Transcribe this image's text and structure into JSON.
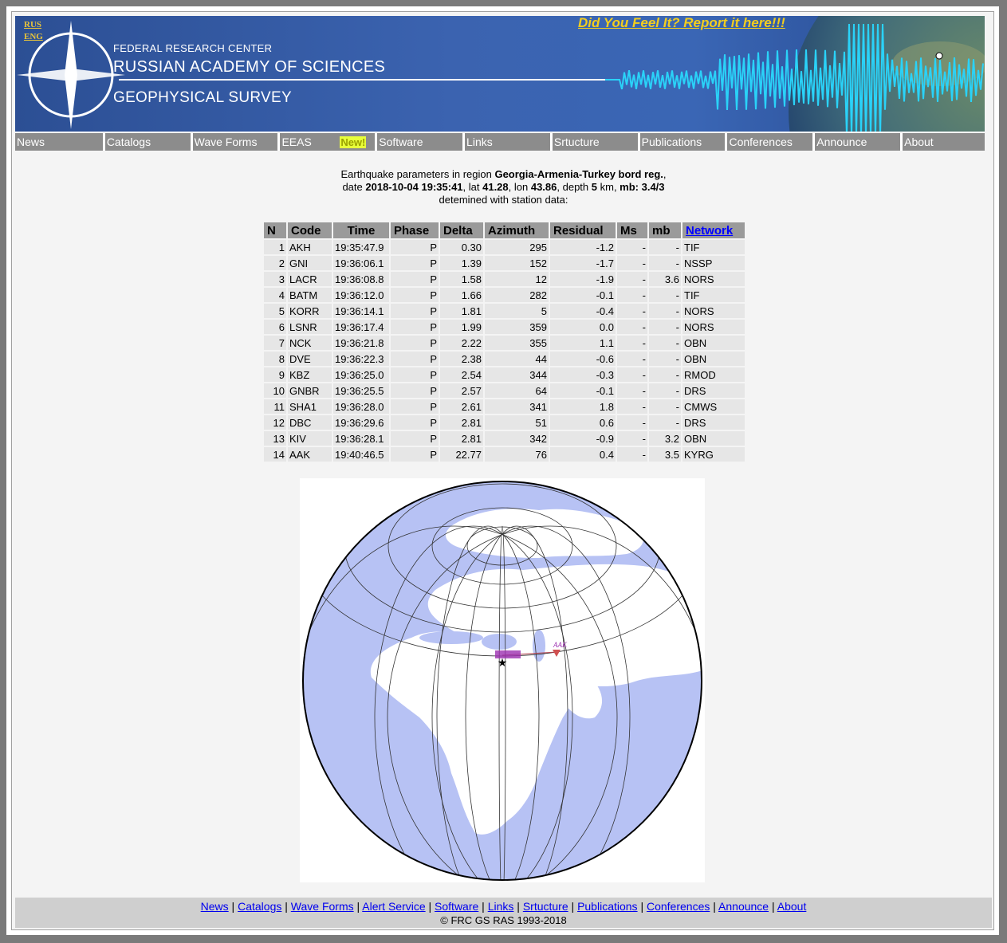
{
  "banner": {
    "lang_rus": "RUS",
    "lang_eng": "ENG",
    "feel_link": "Did You Feel It? Report it here!!!",
    "org_line1": "FEDERAL RESEARCH CENTER",
    "org_line2": "RUSSIAN ACADEMY OF SCIENCES",
    "org_line3": "GEOPHYSICAL SURVEY"
  },
  "nav": [
    "News",
    "Catalogs",
    "Wave Forms",
    "EEAS",
    "New!",
    "Software",
    "Links",
    "Srtucture",
    "Publications",
    "Conferences",
    "Announce",
    "About"
  ],
  "summary": {
    "line1_pre": "Earthquake parameters in region ",
    "region": "Georgia-Armenia-Turkey bord reg.",
    "line1_post": ",",
    "date_label": "date ",
    "date": "2018-10-04 19:35:41",
    "lat_label": ", lat ",
    "lat": "41.28",
    "lon_label": ", lon ",
    "lon": "43.86",
    "depth_label": ", depth ",
    "depth": "5",
    "depth_unit": " km, ",
    "mb_label": "mb: 3.4/3",
    "line3": "detemined with station data:"
  },
  "table": {
    "headers": [
      "N",
      "Code",
      "Time",
      "Phase",
      "Delta",
      "Azimuth",
      "Residual",
      "Ms",
      "mb",
      "Network"
    ],
    "rows": [
      [
        "1",
        "AKH",
        "19:35:47.9",
        "P",
        "0.30",
        "295",
        "-1.2",
        "-",
        "-",
        "TIF"
      ],
      [
        "2",
        "GNI",
        "19:36:06.1",
        "P",
        "1.39",
        "152",
        "-1.7",
        "-",
        "-",
        "NSSP"
      ],
      [
        "3",
        "LACR",
        "19:36:08.8",
        "P",
        "1.58",
        "12",
        "-1.9",
        "-",
        "3.6",
        "NORS"
      ],
      [
        "4",
        "BATM",
        "19:36:12.0",
        "P",
        "1.66",
        "282",
        "-0.1",
        "-",
        "-",
        "TIF"
      ],
      [
        "5",
        "KORR",
        "19:36:14.1",
        "P",
        "1.81",
        "5",
        "-0.4",
        "-",
        "-",
        "NORS"
      ],
      [
        "6",
        "LSNR",
        "19:36:17.4",
        "P",
        "1.99",
        "359",
        "0.0",
        "-",
        "-",
        "NORS"
      ],
      [
        "7",
        "NCK",
        "19:36:21.8",
        "P",
        "2.22",
        "355",
        "1.1",
        "-",
        "-",
        "OBN"
      ],
      [
        "8",
        "DVE",
        "19:36:22.3",
        "P",
        "2.38",
        "44",
        "-0.6",
        "-",
        "-",
        "OBN"
      ],
      [
        "9",
        "KBZ",
        "19:36:25.0",
        "P",
        "2.54",
        "344",
        "-0.3",
        "-",
        "-",
        "RMOD"
      ],
      [
        "10",
        "GNBR",
        "19:36:25.5",
        "P",
        "2.57",
        "64",
        "-0.1",
        "-",
        "-",
        "DRS"
      ],
      [
        "11",
        "SHA1",
        "19:36:28.0",
        "P",
        "2.61",
        "341",
        "1.8",
        "-",
        "-",
        "CMWS"
      ],
      [
        "12",
        "DBC",
        "19:36:29.6",
        "P",
        "2.81",
        "51",
        "0.6",
        "-",
        "-",
        "DRS"
      ],
      [
        "13",
        "KIV",
        "19:36:28.1",
        "P",
        "2.81",
        "342",
        "-0.9",
        "-",
        "3.2",
        "OBN"
      ],
      [
        "14",
        "AAK",
        "19:40:46.5",
        "P",
        "22.77",
        "76",
        "0.4",
        "-",
        "3.5",
        "KYRG"
      ]
    ]
  },
  "map": {
    "station_label": "AAK",
    "ocean_color": "#b7c2f4",
    "land_color": "#ffffff",
    "border_color": "#f0b070"
  },
  "footer": {
    "links": [
      "News",
      "Catalogs",
      "Wave Forms",
      "Alert Service",
      "Software",
      "Links",
      "Srtucture",
      "Publications",
      "Conferences",
      "Announce",
      "About"
    ],
    "separator": " | ",
    "copyright": "© FRC GS RAS 1993-2018"
  }
}
